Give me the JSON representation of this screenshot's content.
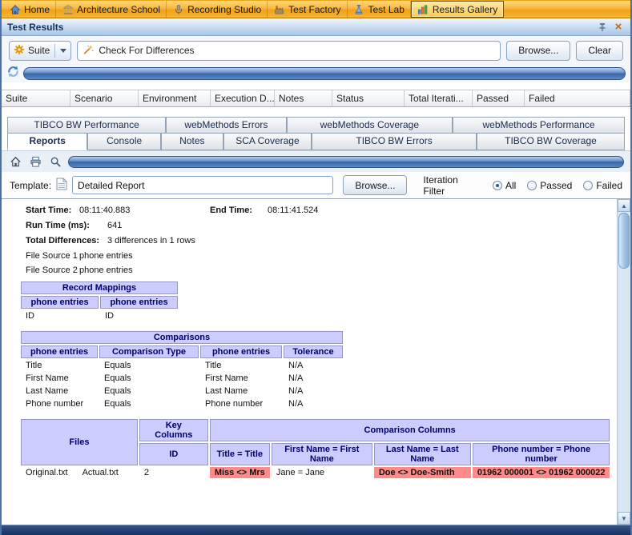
{
  "top_toolbar": {
    "items": [
      {
        "label": "Home"
      },
      {
        "label": "Architecture School"
      },
      {
        "label": "Recording Studio"
      },
      {
        "label": "Test Factory"
      },
      {
        "label": "Test Lab"
      },
      {
        "label": "Results Gallery"
      }
    ],
    "selected": "Results Gallery"
  },
  "panel": {
    "title": "Test Results"
  },
  "suite_bar": {
    "suite_button": "Suite",
    "search_value": "Check For Differences",
    "browse_button": "Browse...",
    "clear_button": "Clear"
  },
  "results_grid": {
    "columns": [
      "Suite",
      "Scenario",
      "Environment",
      "Execution D...",
      "Notes",
      "Status",
      "Total Iterati...",
      "Passed",
      "Failed"
    ]
  },
  "tabs": {
    "row1": [
      "TIBCO BW Performance",
      "webMethods Errors",
      "webMethods Coverage",
      "webMethods Performance"
    ],
    "row2": [
      "Reports",
      "Console",
      "Notes",
      "SCA Coverage",
      "TIBCO BW Errors",
      "TIBCO BW Coverage"
    ],
    "selected": "Reports"
  },
  "template_bar": {
    "label": "Template:",
    "value": "Detailed Report",
    "browse_button": "Browse...",
    "filter_label": "Iteration Filter",
    "radio_all": "All",
    "radio_passed": "Passed",
    "radio_failed": "Failed",
    "selected_filter": "All"
  },
  "report": {
    "start_time_label": "Start Time:",
    "start_time": "08:11:40.883",
    "end_time_label": "End Time:",
    "end_time": "08:11:41.524",
    "run_time_label": "Run Time (ms):",
    "run_time": "641",
    "total_diff_label": "Total Differences:",
    "total_diff": "3 differences in 1 rows",
    "file_source_1_label": "File Source 1",
    "file_source_1": "phone entries",
    "file_source_2_label": "File Source 2",
    "file_source_2": "phone entries",
    "record_mappings": {
      "title": "Record Mappings",
      "headers": [
        "phone entries",
        "phone entries"
      ],
      "rows": [
        [
          "ID",
          "ID"
        ]
      ]
    },
    "comparisons": {
      "title": "Comparisons",
      "headers": [
        "phone entries",
        "Comparison Type",
        "phone entries",
        "Tolerance"
      ],
      "rows": [
        [
          "Title",
          "Equals",
          "Title",
          "N/A"
        ],
        [
          "First Name",
          "Equals",
          "First Name",
          "N/A"
        ],
        [
          "Last Name",
          "Equals",
          "Last Name",
          "N/A"
        ],
        [
          "Phone number",
          "Equals",
          "Phone number",
          "N/A"
        ]
      ]
    },
    "files_table": {
      "files_header": "Files",
      "key_columns_header": "Key Columns",
      "comparison_columns_header": "Comparison Columns",
      "key_sub_header": "ID",
      "comparison_sub_headers": [
        "Title = Title",
        "First Name = First Name",
        "Last Name = Last Name",
        "Phone number = Phone number"
      ],
      "row": {
        "file_1": "Original.txt",
        "file_2": "Actual.txt",
        "key_value": "2",
        "cells": [
          {
            "text": "Miss <> Mrs",
            "diff": true
          },
          {
            "text": "Jane = Jane",
            "diff": false
          },
          {
            "text": "Doe <> Doe-Smith",
            "diff": true
          },
          {
            "text": "01962 000001 <> 01962 000022",
            "diff": true
          }
        ]
      }
    }
  },
  "colors": {
    "toolbar_orange": "#f6b53a",
    "header_lavender": "#ccccff",
    "diff_red": "#ff8a8a",
    "gloss_blue": "#3a66a8"
  }
}
